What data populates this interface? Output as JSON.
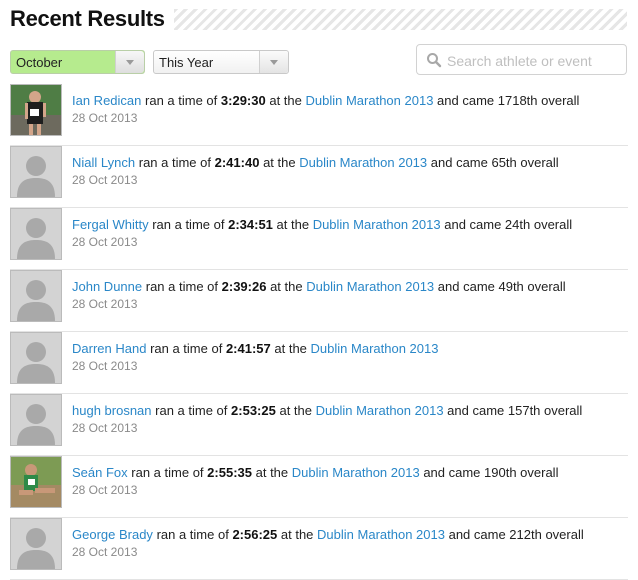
{
  "header": {
    "title": "Recent Results"
  },
  "filters": {
    "month": "October",
    "year": "This Year",
    "search_placeholder": "Search athlete or event"
  },
  "results": [
    {
      "athlete": "Ian Redican",
      "text1": "ran a time of",
      "time": "3:29:30",
      "text2": "at the",
      "event": "Dublin Marathon 2013",
      "placement": "and came 1718th overall",
      "date": "28 Oct 2013",
      "avatar": "photo-runner"
    },
    {
      "athlete": "Niall Lynch",
      "text1": "ran a time of",
      "time": "2:41:40",
      "text2": "at the",
      "event": "Dublin Marathon 2013",
      "placement": "and came 65th overall",
      "date": "28 Oct 2013",
      "avatar": "default"
    },
    {
      "athlete": "Fergal Whitty",
      "text1": "ran a time of",
      "time": "2:34:51",
      "text2": "at the",
      "event": "Dublin Marathon 2013",
      "placement": "and came 24th overall",
      "date": "28 Oct 2013",
      "avatar": "default"
    },
    {
      "athlete": "John Dunne",
      "text1": "ran a time of",
      "time": "2:39:26",
      "text2": "at the",
      "event": "Dublin Marathon 2013",
      "placement": "and came 49th overall",
      "date": "28 Oct 2013",
      "avatar": "default"
    },
    {
      "athlete": "Darren Hand",
      "text1": "ran a time of",
      "time": "2:41:57",
      "text2": "at the",
      "event": "Dublin Marathon 2013",
      "placement": "",
      "date": "28 Oct 2013",
      "avatar": "default"
    },
    {
      "athlete": "hugh brosnan",
      "text1": "ran a time of",
      "time": "2:53:25",
      "text2": "at the",
      "event": "Dublin Marathon 2013",
      "placement": "and came 157th overall",
      "date": "28 Oct 2013",
      "avatar": "default"
    },
    {
      "athlete": "Seán Fox",
      "text1": "ran a time of",
      "time": "2:55:35",
      "text2": "at the",
      "event": "Dublin Marathon 2013",
      "placement": "and came 190th overall",
      "date": "28 Oct 2013",
      "avatar": "photo-seated"
    },
    {
      "athlete": "George Brady",
      "text1": "ran a time of",
      "time": "2:56:25",
      "text2": "at the",
      "event": "Dublin Marathon 2013",
      "placement": "and came 212th overall",
      "date": "28 Oct 2013",
      "avatar": "default"
    }
  ],
  "colors": {
    "link": "#2a87c8",
    "month_select_bg": "#b6eb8e",
    "date_text": "#8a8a8a"
  }
}
